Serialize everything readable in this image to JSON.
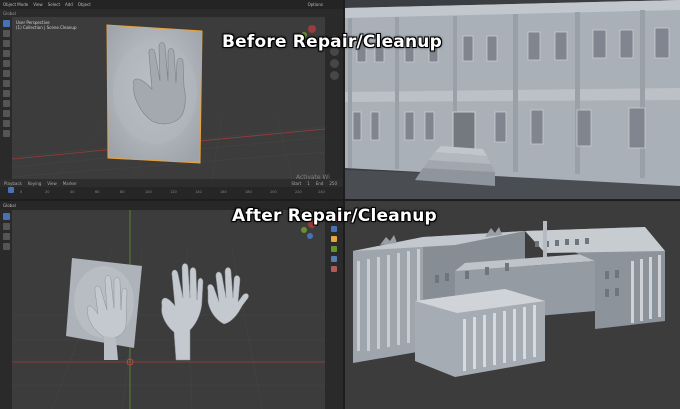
{
  "overlay": {
    "before_title": "Before Repair/Cleanup",
    "after_title": "After Repair/Cleanup",
    "watermark": "Activate Wi"
  },
  "blender_top": {
    "menu": [
      "Object Mode",
      "View",
      "Select",
      "Add",
      "Object"
    ],
    "transform": "Global",
    "options": "Options",
    "viewport_info": [
      "User Perspective",
      "(1) Collection | Scene.Cleanup"
    ]
  },
  "timeline": {
    "menu": [
      "Playback",
      "Keying",
      "View",
      "Marker"
    ],
    "frame_ticks": [
      "0",
      "20",
      "40",
      "60",
      "80",
      "100",
      "120",
      "140",
      "160",
      "180",
      "200",
      "220",
      "240"
    ],
    "start_label": "Start",
    "end_label": "End",
    "start_value": "1",
    "end_value": "250"
  },
  "blender_bottom": {
    "header": "Global"
  },
  "colors": {
    "blender_bg": "#3c3c3c",
    "grid_red": "#9b3b3b",
    "grid_green": "#6a8f2d",
    "active_blue": "#4772b3",
    "selection_orange": "#e8a33c",
    "model_gray": "#b9bec6"
  }
}
